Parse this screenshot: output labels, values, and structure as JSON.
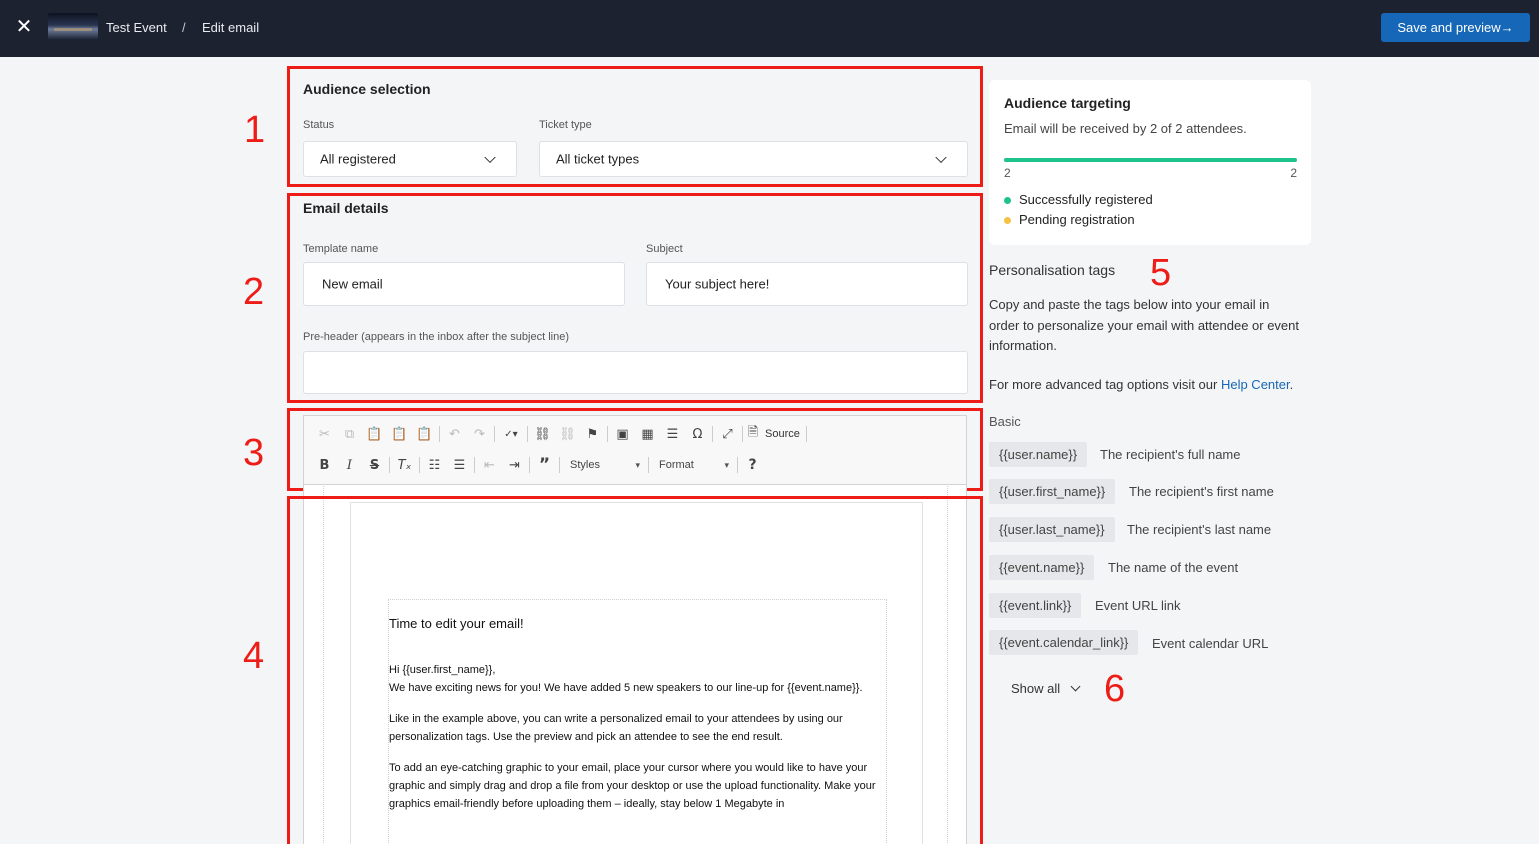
{
  "header": {
    "close_icon": "close-icon",
    "event_name": "Test Event",
    "separator": "/",
    "page_title": "Edit email",
    "save_label": "Save and preview→",
    "colors": {
      "bar": "#1d2230",
      "primary": "#1667b7"
    }
  },
  "annotations": [
    "1",
    "2",
    "3",
    "4",
    "5",
    "6"
  ],
  "audience": {
    "title": "Audience selection",
    "status_label": "Status",
    "status_value": "All registered",
    "ticket_label": "Ticket type",
    "ticket_value": "All ticket types"
  },
  "details": {
    "title": "Email details",
    "template_label": "Template name",
    "template_value": "New email",
    "subject_label": "Subject",
    "subject_value": "Your subject here!",
    "preheader_label": "Pre-header (appears in the inbox after the subject line)",
    "preheader_value": ""
  },
  "toolbar": {
    "row1_icons": [
      "cut-icon",
      "copy-icon",
      "paste-icon",
      "paste-text-icon",
      "paste-word-icon",
      "undo-icon",
      "redo-icon",
      "spellcheck-icon",
      "link-icon",
      "unlink-icon",
      "anchor-icon",
      "image-icon",
      "table-icon",
      "horizontal-line-icon",
      "special-char-icon",
      "maximize-icon",
      "source-icon"
    ],
    "source_label": "Source",
    "row2_icons": [
      "bold-icon",
      "italic-icon",
      "strike-icon",
      "remove-format-icon",
      "numbered-list-icon",
      "bulleted-list-icon",
      "outdent-icon",
      "indent-icon",
      "blockquote-icon",
      "help-icon"
    ],
    "styles_label": "Styles",
    "format_label": "Format"
  },
  "email": {
    "heading": "Time to edit your email!",
    "greeting": "Hi {{user.first_name}},",
    "line1": "We have exciting news for you! We have added 5 new speakers to our line-up for {{event.name}}.",
    "para2": "Like in the example above, you can write a personalized email to your attendees by using our personalization tags. Use the preview and pick an attendee to see the end result.",
    "para3": "To add an eye-catching graphic to your email, place your cursor where you would like to have your graphic and simply drag and drop a file from your desktop or use the upload functionality. Make your graphics email-friendly before uploading them – ideally, stay below 1 Megabyte in"
  },
  "targeting": {
    "title": "Audience targeting",
    "summary": "Email will be received by 2 of 2 attendees.",
    "progress_fraction": 1.0,
    "min_label": "2",
    "max_label": "2",
    "legend": [
      {
        "label": "Successfully registered",
        "color": "#1ec28b"
      },
      {
        "label": "Pending registration",
        "color": "#f5c242"
      }
    ]
  },
  "tags": {
    "title": "Personalisation tags",
    "intro": "Copy and paste the tags below into your email in order to personalize your email with attendee or event information.",
    "advanced_prefix": "For more advanced tag options visit our ",
    "advanced_link": "Help Center",
    "advanced_suffix": ".",
    "group": "Basic",
    "items": [
      {
        "tag": "{{user.name}}",
        "desc": "The recipient's full name"
      },
      {
        "tag": "{{user.first_name}}",
        "desc": "The recipient's first name"
      },
      {
        "tag": "{{user.last_name}}",
        "desc": "The recipient's last name"
      },
      {
        "tag": "{{event.name}}",
        "desc": "The name of the event"
      },
      {
        "tag": "{{event.link}}",
        "desc": "Event URL link"
      },
      {
        "tag": "{{event.calendar_link}}",
        "desc": "Event calendar URL"
      }
    ],
    "show_all": "Show all"
  }
}
